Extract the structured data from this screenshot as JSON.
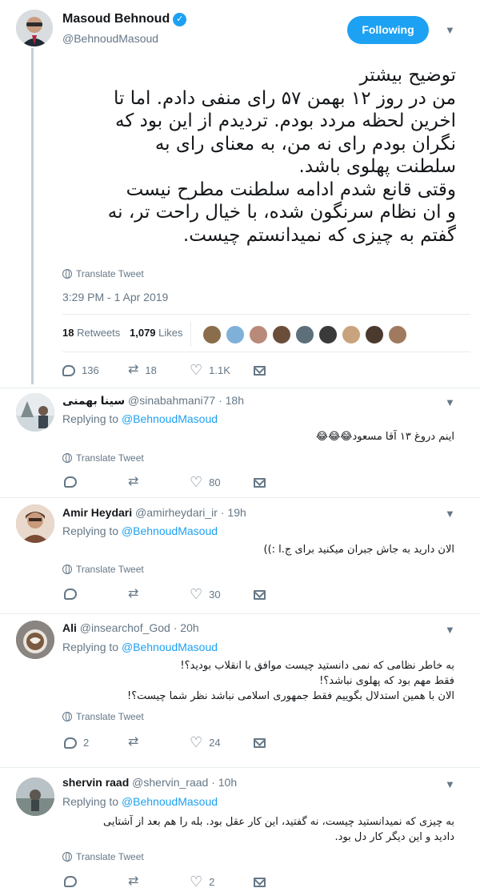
{
  "main_tweet": {
    "author": {
      "name": "Masoud Behnoud",
      "handle": "@BehnoudMasoud",
      "avatar": "avatar"
    },
    "follow_label": "Following",
    "text_lines": [
      "توضیح بیشتر",
      "من در روز ۱۲ بهمن ۵۷ رای منفی دادم. اما تا",
      "اخرین لحظه مردد بودم. تردیدم از این بود که",
      "نگران بودم رای نه من، به معنای رای به",
      "سلطنت پهلوی باشد.",
      "وقتی قانع شدم ادامه سلطنت مطرح نیست",
      "و ان نظام سرنگون شده، با خیال راحت تر، نه",
      "گفتم به چیزی که نمیدانستم چیست."
    ],
    "translate_label": "Translate Tweet",
    "timestamp": "3:29 PM - 1 Apr 2019",
    "retweets_count": "18",
    "retweets_label": "Retweets",
    "likes_count": "1,079",
    "likes_label": "Likes",
    "likers": [
      {
        "color": "#8a6d4b"
      },
      {
        "color": "#7fb0d8"
      },
      {
        "color": "#b98a7a"
      },
      {
        "color": "#6b4e3a"
      },
      {
        "color": "#5d6f7a"
      },
      {
        "color": "#3a3a3a"
      },
      {
        "color": "#c9a37d"
      },
      {
        "color": "#4b3a2e"
      },
      {
        "color": "#a07a5e"
      }
    ],
    "actions": {
      "reply_count": "136",
      "retweet_count": "18",
      "like_count": "1.1K"
    }
  },
  "replies": [
    {
      "name": "سینا بهمنی",
      "handle": "@sinabahmani77",
      "time": "18h",
      "replying_prefix": "Replying to",
      "replying_to": "@BehnoudMasoud",
      "text_lines": [
        "اینم دروغ ۱۳ آقا مسعود😂😂😂"
      ],
      "translate_label": "Translate Tweet",
      "reply_count": "",
      "retweet_count": "",
      "like_count": "80",
      "avatar_color": "#9aa7a0"
    },
    {
      "name": "Amir Heydari",
      "handle": "@amirheydari_ir",
      "time": "19h",
      "replying_prefix": "Replying to",
      "replying_to": "@BehnoudMasoud",
      "text_lines": [
        "الان دارید به جاش جبران میکنید برای ج.ا :))"
      ],
      "translate_label": "Translate Tweet",
      "reply_count": "",
      "retweet_count": "",
      "like_count": "30",
      "avatar_color": "#b07a5c"
    },
    {
      "name": "Ali",
      "handle": "@insearchof_God",
      "time": "20h",
      "replying_prefix": "Replying to",
      "replying_to": "@BehnoudMasoud",
      "text_lines": [
        "به خاطر نظامی که نمی دانستید چیست موافق با انقلاب بودید؟!",
        "فقط مهم بود که پهلوی نباشد؟!",
        "الان با همین استدلال بگوییم فقط جمهوری اسلامی نباشد نظر شما چیست؟!"
      ],
      "translate_label": "Translate Tweet",
      "reply_count": "2",
      "retweet_count": "",
      "like_count": "24",
      "avatar_color": "#6e6a63"
    },
    {
      "name": "shervin raad",
      "handle": "@shervin_raad",
      "time": "10h",
      "replying_prefix": "Replying to",
      "replying_to": "@BehnoudMasoud",
      "text_lines": [
        "به چیزی که نمیدانستید چیست، نه گفتید، این کار عقل بود. بله را هم  بعد از آشتایی",
        "دادید و این دیگر کار دل بود."
      ],
      "translate_label": "Translate Tweet",
      "reply_count": "",
      "retweet_count": "",
      "like_count": "2",
      "avatar_color": "#8d948f"
    }
  ]
}
